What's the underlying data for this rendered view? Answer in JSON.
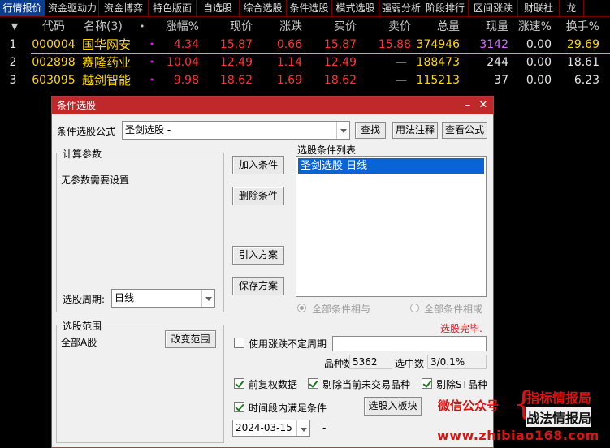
{
  "tabs": [
    "行情报价",
    "资金驱动力",
    "资金博弈",
    "特色版面",
    "自选股",
    "综合选股",
    "条件选股",
    "模式选股",
    "强弱分析",
    "阶段排行",
    "区间涨跌",
    "财联社",
    "龙"
  ],
  "table": {
    "headers": {
      "arrow": "▼",
      "code": "代码",
      "name": "名称(3)",
      "dot": "•",
      "change_pct": "涨幅%",
      "price": "现价",
      "change": "涨跌",
      "bid": "买价",
      "ask": "卖价",
      "volume": "总量",
      "cur_vol": "现量",
      "speed": "涨速%",
      "turnover": "换手%"
    },
    "rows": [
      {
        "idx": "1",
        "code": "000004",
        "name": "国华网安",
        "mark": "•",
        "change_pct": "4.34",
        "price": "15.87",
        "change": "0.66",
        "bid": "15.87",
        "ask": "15.88",
        "volume": "374946",
        "cur_vol": "3142",
        "speed": "0.00",
        "turnover": "29.69"
      },
      {
        "idx": "2",
        "code": "002898",
        "name": "赛隆药业",
        "mark": "•",
        "change_pct": "10.04",
        "price": "12.49",
        "change": "1.14",
        "bid": "12.49",
        "ask": "—",
        "volume": "188473",
        "cur_vol": "244",
        "speed": "0.00",
        "turnover": "18.61"
      },
      {
        "idx": "3",
        "code": "603095",
        "name": "越剑智能",
        "mark": "•",
        "change_pct": "9.98",
        "price": "18.62",
        "change": "1.69",
        "bid": "18.62",
        "ask": "—",
        "volume": "115213",
        "cur_vol": "37",
        "speed": "0.00",
        "turnover": "6.23"
      }
    ]
  },
  "dialog": {
    "title": "条件选股",
    "formula_label": "条件选股公式",
    "formula_value": "圣剑选股  -",
    "btn_find": "查找",
    "btn_usage": "用法注释",
    "btn_view": "查看公式",
    "params_group": "计算参数",
    "no_params": "无参数需要设置",
    "btn_add": "加入条件",
    "btn_delete": "删除条件",
    "btn_import": "引入方案",
    "btn_save": "保存方案",
    "list_label": "选股条件列表",
    "list_items": [
      "圣剑选股  日线"
    ],
    "period_label": "选股周期:",
    "period_value": "日线",
    "radio_and": "全部条件相与",
    "radio_or": "全部条件相或",
    "status": "选股完毕.",
    "range_group": "选股范围",
    "range_value": "全部A股",
    "btn_change_range": "改变范围",
    "use_variable_period": "使用涨跌不定周期",
    "count_label": "品种数",
    "count_value": "5362",
    "selected_label": "选中数",
    "selected_value": "3/0.1%",
    "cb_rights": "前复权数据",
    "cb_remove_untraded": "剔除当前未交易品种",
    "cb_remove_st": "剔除ST品种",
    "cb_time_range": "时间段内满足条件",
    "btn_to_block": "选股入板块",
    "date_value": "2024-03-15",
    "date_dash": "-"
  },
  "watermark": {
    "wechat": "微信公众号",
    "brace": "{",
    "line1": "指标情报局",
    "line2": "战法情报局",
    "site": "www.zhibiao168.com"
  }
}
